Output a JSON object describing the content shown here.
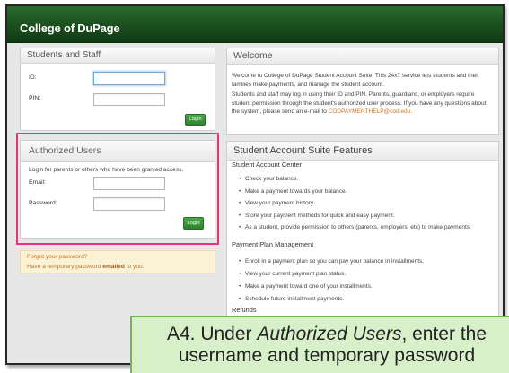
{
  "header": {
    "title": "College of DuPage"
  },
  "students_staff": {
    "title": "Students and Staff",
    "id_label": "ID:",
    "id_value": "",
    "pin_label": "PIN:",
    "pin_value": "",
    "login_label": "Login"
  },
  "authorized_users": {
    "title": "Authorized Users",
    "description": "Login for parents or others who have been granted access.",
    "email_label": "Email:",
    "email_value": "",
    "password_label": "Password:",
    "password_value": "",
    "login_label": "Login"
  },
  "password_help": {
    "forgot_link": "Forgot your password?",
    "temporary_prefix": "Have a temporary password ",
    "temporary_link": "emailed",
    "temporary_suffix": " to you."
  },
  "welcome": {
    "title": "Welcome",
    "paragraph_1": "Welcome to College of DuPage Student Account Suite. This 24x7 service lets students and their families make payments, and manage the student account.",
    "paragraph_2": "Students and staff may log in using their ID and PIN. Parents, guardians, or employers require student permission through the student's authorized user process. If you have any questions about the system, please send an e-mail to ",
    "support_email": "CODPAYMENTHELP@cod.edu",
    "paragraph_2_end": "."
  },
  "features": {
    "title": "Student Account Suite Features",
    "sections": [
      {
        "heading": "Student Account Center",
        "items": [
          "Check your balance.",
          "Make a payment towards your balance.",
          "View your payment history.",
          "Store your payment methods for quick and easy payment.",
          "As a student, provide permission to others (parents, employers, etc) to make payments."
        ]
      },
      {
        "heading": "Payment Plan Management",
        "items": [
          "Enroll in a payment plan so you can pay your balance in installments.",
          "View your current payment plan status.",
          "Make a payment toward one of your installments.",
          "Schedule future installment payments."
        ]
      },
      {
        "heading": "Refunds"
      }
    ]
  },
  "callout": {
    "line_1_prefix": "A4. Under ",
    "line_1_emphasis": "Authorized Users",
    "line_1_suffix": ", enter the",
    "line_2": "username and temporary password"
  },
  "colors": {
    "header_green": "#1e5321",
    "highlight_pink": "#e8337a",
    "callout_fill": "#d8f0c9",
    "callout_border": "#78b257",
    "login_green": "#2f842f",
    "link_orange": "#c4782c"
  }
}
